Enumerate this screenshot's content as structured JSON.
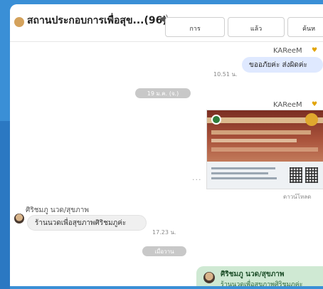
{
  "header": {
    "title": "สถานประกอบการเพื่อสุข...(96)",
    "bell_icon": "speaker-icon",
    "buttons": [
      "การ",
      "แล้ว",
      "ค้นห"
    ]
  },
  "messages": {
    "msg1": {
      "sender": "KAReeM",
      "text": "ขออภัยค่ะ ส่งผิดค่ะ",
      "time": "10.51 น."
    },
    "date_divider": "19 ม.ค. (จ.)",
    "msg2": {
      "sender": "KAReeM",
      "download": "ดาวน์โหลด"
    },
    "msg3": {
      "sender": "ศิริชมภู นวด/สุขภาพ",
      "text": "ร้านนวดเพื่อสุขภาพศิริชมภูค่ะ",
      "time": "17.23 น."
    },
    "divider2": "เมื่อวาน",
    "reply": {
      "name": "ศิริชมภู นวด/สุขภาพ",
      "text": "ร้านนวดเพื่อสุขภาพศิริชมภูค่ะ"
    }
  },
  "colors": {
    "background": "#3a8fd6",
    "outgoing_bubble": "#dfe9ff",
    "reply_card": "#cfe9d3"
  }
}
